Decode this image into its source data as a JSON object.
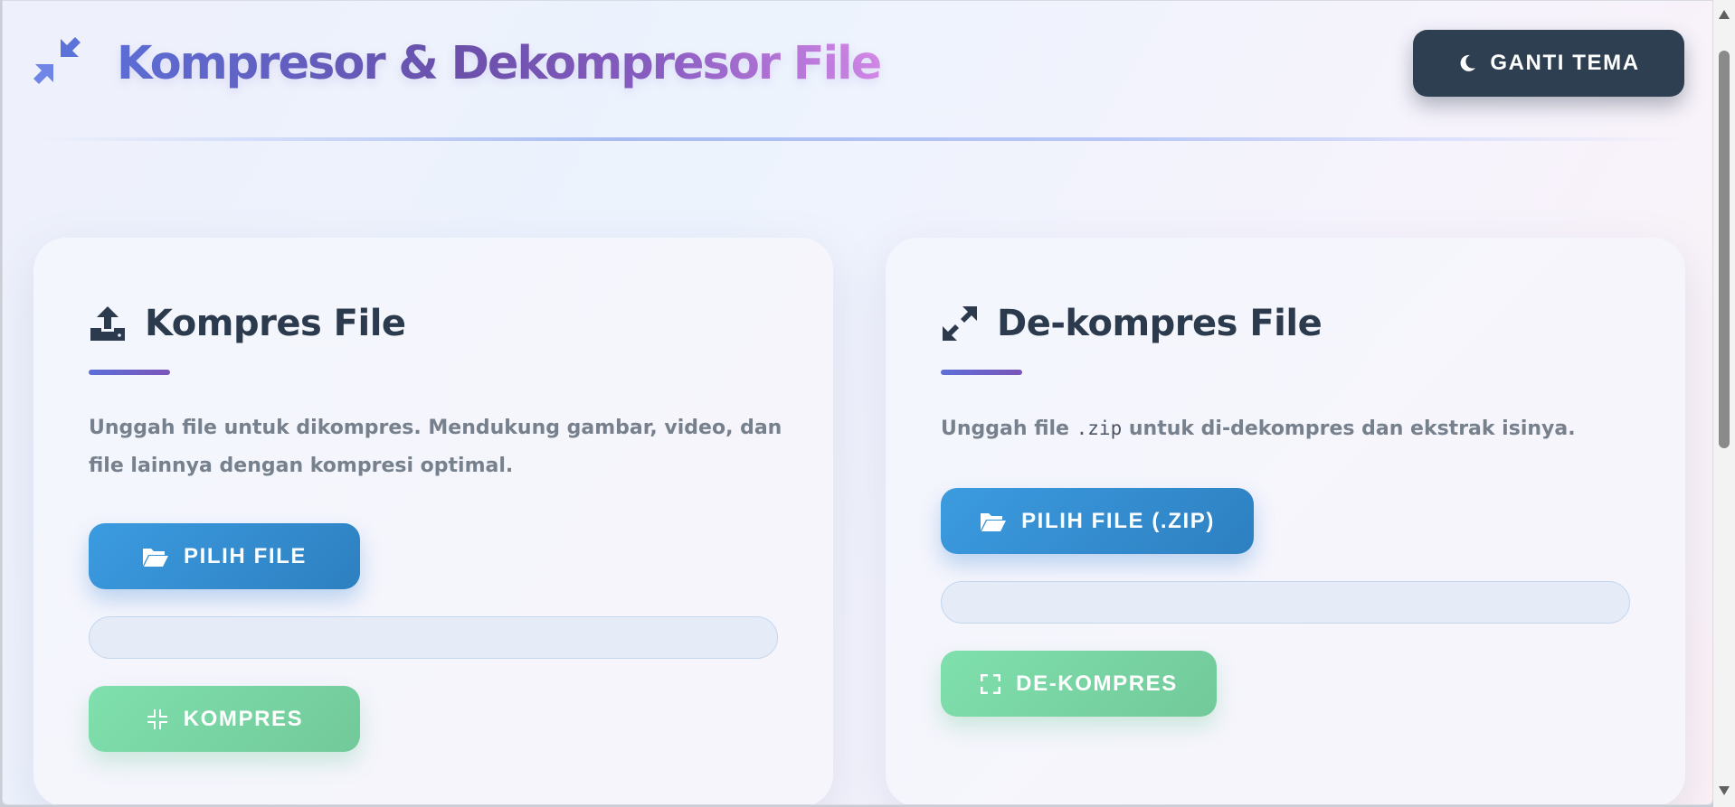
{
  "header": {
    "title": "Kompresor & Dekompresor File",
    "logo_icon": "compress-arrows-icon",
    "theme_button": {
      "label": "GANTI TEMA",
      "icon": "moon-icon"
    }
  },
  "compress_card": {
    "title": "Kompres File",
    "icon": "upload-icon",
    "description": "Unggah file untuk dikompres. Mendukung gambar, video, dan file lainnya dengan kompresi optimal.",
    "choose_button": {
      "label": "PILIH FILE",
      "icon": "folder-open-icon"
    },
    "progress_value": 0,
    "action_button": {
      "label": "KOMPRES",
      "icon": "compress-icon"
    }
  },
  "decompress_card": {
    "title": "De-kompres File",
    "icon": "expand-arrows-icon",
    "description_prefix": "Unggah file",
    "description_code": ".zip",
    "description_suffix": "untuk di-dekompres dan ekstrak isinya.",
    "choose_button": {
      "label": "PILIH FILE (.ZIP)",
      "icon": "folder-open-icon"
    },
    "progress_value": 0,
    "action_button": {
      "label": "DE-KOMPRES",
      "icon": "expand-icon"
    }
  },
  "colors": {
    "primary_blue": "#3498db",
    "success_green": "#7fdcab",
    "dark": "#2f3f52",
    "accent_purple": "#7a55b8"
  }
}
